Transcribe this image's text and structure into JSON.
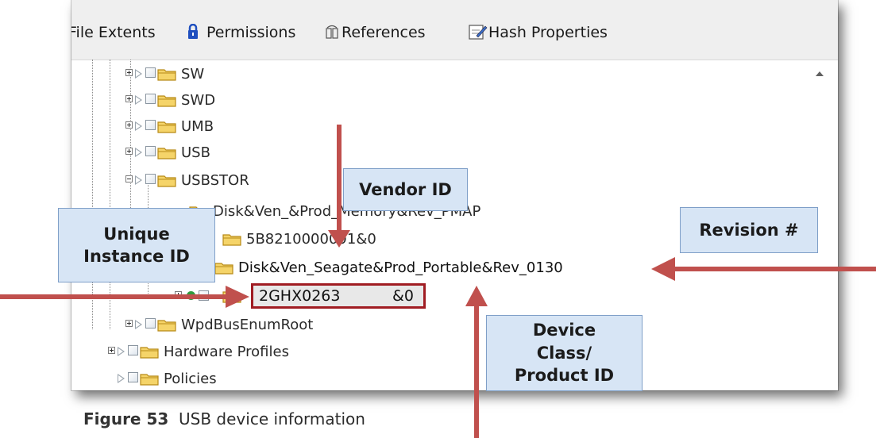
{
  "toolbar": {
    "file_extents": "File Extents",
    "permissions": "Permissions",
    "references": "References",
    "hash_properties": "Hash Properties"
  },
  "tree": {
    "sw": "SW",
    "swd": "SWD",
    "umb": "UMB",
    "usb": "USB",
    "usbstor": "USBSTOR",
    "disk1": "Disk&Ven_&Prod_Memory&Rev_PMAP",
    "serial1": "5B8210000091&0",
    "disk2": "Disk&Ven_Seagate&Prod_Portable&Rev_0130",
    "serial2_a": "2GHX0263",
    "serial2_b": "&0",
    "wpd": "WpdBusEnumRoot",
    "hw_profiles": "Hardware Profiles",
    "policies": "Policies"
  },
  "callouts": {
    "vendor_id": "Vendor ID",
    "unique_instance_id": "Unique Instance ID",
    "revision": "Revision #",
    "device_class": "Device Class/ Product ID"
  },
  "caption": {
    "figure": "Figure 53",
    "text": "USB device information"
  },
  "colors": {
    "arrow": "#c0504d",
    "highlight_border": "#a01c22",
    "callout_fill": "#d7e5f5",
    "callout_border": "#7f9fc8",
    "folder": "#f5d469"
  }
}
